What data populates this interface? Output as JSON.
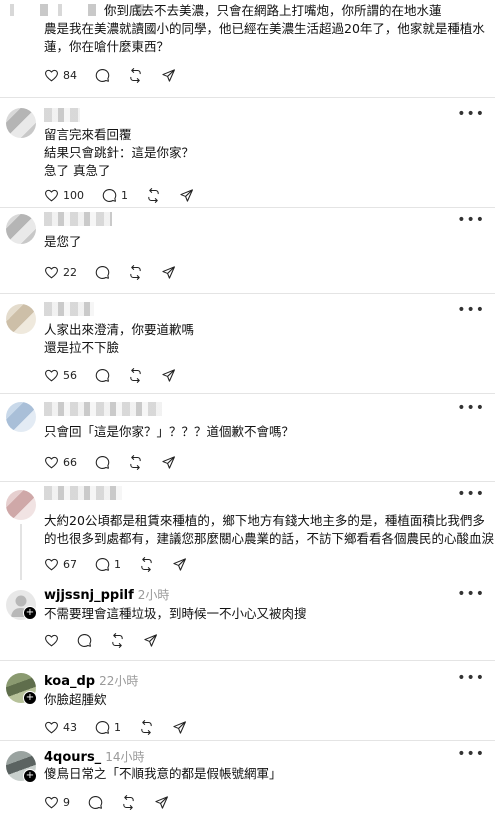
{
  "posts": [
    {
      "name": "",
      "lines": [
        "你到底去不去美濃，只會在網路上打嘴炮，你所謂的在地水蓮",
        "農是我在美濃就讀國小的同學，他已經在美濃生活超過20年了，他家就是種植水",
        "蓮，你在嗆什麼東西？"
      ],
      "likes": "84",
      "replies": ""
    },
    {
      "name": "",
      "lines": [
        "留言完來看回覆",
        "結果只會跳針：這是你家？",
        "急了 真急了"
      ],
      "likes": "100",
      "replies": "1"
    },
    {
      "name": "",
      "lines": [
        "是您了"
      ],
      "likes": "22",
      "replies": ""
    },
    {
      "name": "",
      "lines": [
        "人家出來澄清，你要道歉嗎",
        "還是拉不下臉"
      ],
      "likes": "56",
      "replies": ""
    },
    {
      "name": "",
      "lines": [
        "只會回「這是你家？」？？？道個歉不會嗎？"
      ],
      "likes": "66",
      "replies": ""
    },
    {
      "name": "",
      "lines": [
        "大約20公頃都是租賃來種植的，鄉下地方有錢大地主多的是，種植面積比我們多",
        "的也很多到處都有，建議您那麼關心農業的話，不訪下鄉看看各個農民的心酸血淚"
      ],
      "likes": "67",
      "replies": "1"
    },
    {
      "name": "wjjssnj_ppilf",
      "time": "2小時",
      "lines": [
        "不需要理會這種垃圾，到時候一不小心又被肉搜"
      ],
      "likes": "",
      "replies": ""
    },
    {
      "name": "koa_dp",
      "time": "22小時",
      "lines": [
        "你臉超腫欸"
      ],
      "likes": "43",
      "replies": "1"
    },
    {
      "name": "4qours_",
      "time": "14小時",
      "lines": [
        "傻鳥日常之「不順我意的都是假帳號網軍」"
      ],
      "likes": "9",
      "replies": ""
    }
  ],
  "icons": {
    "like": "heart-icon",
    "reply": "comment-icon",
    "repost": "repost-icon",
    "share": "share-icon",
    "more": "more-icon"
  }
}
